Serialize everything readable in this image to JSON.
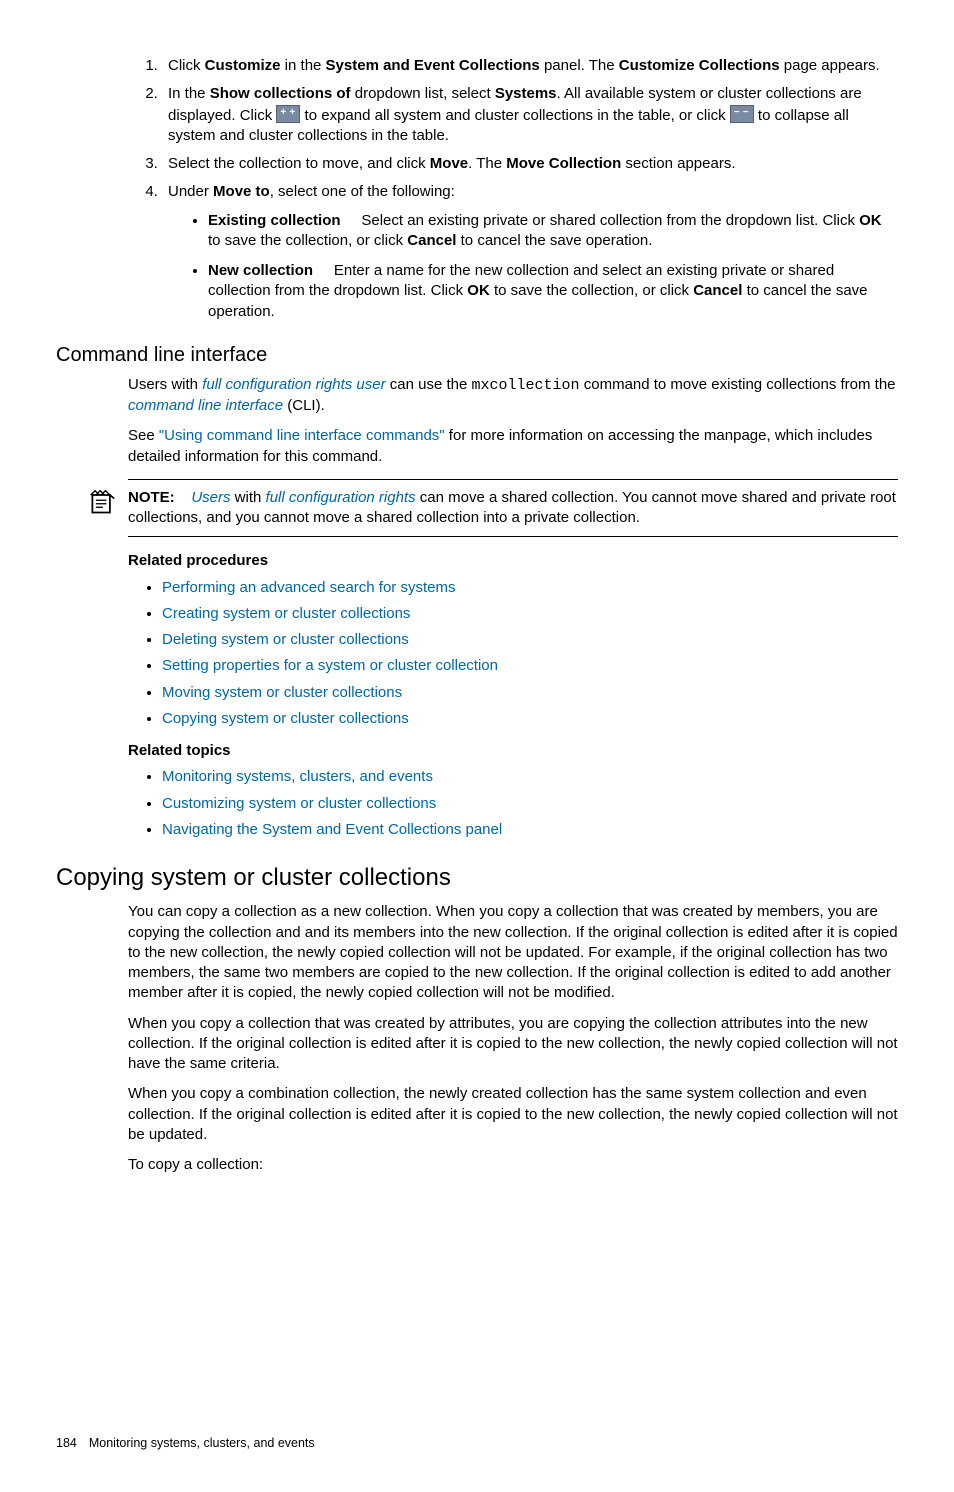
{
  "steps": {
    "s1_a": "Click ",
    "s1_b": "Customize",
    "s1_c": " in the ",
    "s1_d": "System and Event Collections",
    "s1_e": " panel. The ",
    "s1_f": "Customize Collections",
    "s1_g": " page appears.",
    "s2_a": "In the ",
    "s2_b": "Show collections of",
    "s2_c": " dropdown list, select ",
    "s2_d": "Systems",
    "s2_e": ". All available system or cluster collections are displayed. Click ",
    "s2_f": " to expand all system and cluster collections in the table, or click ",
    "s2_g": " to collapse all system and cluster collections in the table.",
    "s3_a": "Select the collection to move, and click ",
    "s3_b": "Move",
    "s3_c": ". The ",
    "s3_d": "Move Collection",
    "s3_e": " section appears.",
    "s4_a": "Under ",
    "s4_b": "Move to",
    "s4_c": ", select one of the following:",
    "sub1_label": "Existing collection",
    "sub1_a": "Select an existing private or shared collection from the dropdown list. Click ",
    "sub1_b": "OK",
    "sub1_c": " to save the collection, or click ",
    "sub1_d": "Cancel",
    "sub1_e": " to cancel the save operation.",
    "sub2_label": "New collection",
    "sub2_a": "Enter a name for the new collection and select an existing private or shared collection from the dropdown list. Click ",
    "sub2_b": "OK",
    "sub2_c": " to save the collection, or click ",
    "sub2_d": "Cancel",
    "sub2_e": " to cancel the save operation."
  },
  "cli": {
    "heading": "Command line interface",
    "p1_a": "Users with ",
    "p1_b": "full configuration rights user",
    "p1_c": " can use the ",
    "p1_cmd": "mxcollection",
    "p1_d": " command to move existing collections from the ",
    "p1_e": "command line interface",
    "p1_f": " (CLI).",
    "p2_a": "See ",
    "p2_b": "\"Using command line interface commands\"",
    "p2_c": " for more information on accessing the manpage, which includes detailed information for this command."
  },
  "note": {
    "label": "NOTE:",
    "a": "Users",
    "b": " with ",
    "c": "full configuration rights",
    "d": " can move a shared collection. You cannot move shared and private root collections, and you cannot move a shared collection into a private collection."
  },
  "related_procedures": {
    "heading": "Related procedures",
    "items": [
      "Performing an advanced search for systems",
      "Creating system or cluster collections",
      "Deleting system or cluster collections",
      "Setting properties for a system or cluster collection",
      "Moving system or cluster collections",
      "Copying system or cluster collections"
    ]
  },
  "related_topics": {
    "heading": "Related topics",
    "items": [
      "Monitoring systems, clusters, and events",
      "Customizing system or cluster collections",
      "Navigating the System and Event Collections panel"
    ]
  },
  "copying": {
    "heading": "Copying system or cluster collections",
    "p1": "You can copy a collection as a new collection. When you copy a collection that was created by members, you are copying the collection and and its members into the new collection. If the original collection is edited after it is copied to the new collection, the newly copied collection will not be updated. For example, if the original collection has two members, the same two members are copied to the new collection. If the original collection is edited to add another member after it is copied, the newly copied collection will not be modified.",
    "p2": "When you copy a collection that was created by attributes, you are copying the collection attributes into the new collection. If the original collection is edited after it is copied to the new collection, the newly copied collection will not have the same criteria.",
    "p3": "When you copy a combination collection, the newly created collection has the same system collection and even collection. If the original collection is edited after it is copied to the new collection, the newly copied collection will not be updated.",
    "p4": "To copy a collection:"
  },
  "footer": {
    "page": "184",
    "text": "Monitoring systems, clusters, and events"
  }
}
